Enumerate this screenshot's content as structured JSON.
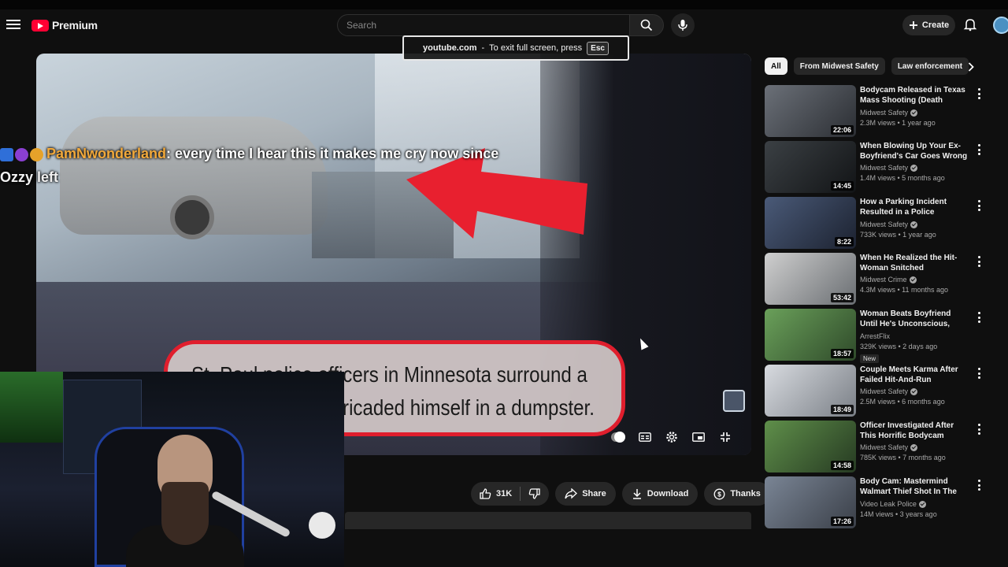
{
  "header": {
    "logo_text": "Premium",
    "search_placeholder": "Search",
    "create_label": "Create"
  },
  "fullscreen_toast": {
    "host": "youtube.com",
    "separator": "-",
    "message": "To exit full screen, press",
    "key": "Esc"
  },
  "video": {
    "caption_line1": "St. Paul police officers in Minnesota surround a",
    "caption_line2": "rricaded himself in a dumpster."
  },
  "chat": {
    "username": "PamNwonderland",
    "message": ": every time I hear this it makes me cry now since",
    "message_cont": "Ozzy left"
  },
  "actions": {
    "likes": "31K",
    "share": "Share",
    "download": "Download",
    "thanks": "Thanks"
  },
  "chips": [
    "All",
    "From Midwest Safety",
    "Law enforcement"
  ],
  "recommendations": [
    {
      "title": "Bodycam Released in Texas Mass Shooting (Death Penalty…",
      "channel": "Midwest Safety",
      "verified": true,
      "meta": "2.3M views • 1 year ago",
      "duration": "22:06",
      "new": ""
    },
    {
      "title": "When Blowing Up Your Ex-Boyfriend's Car Goes Wrong",
      "channel": "Midwest Safety",
      "verified": true,
      "meta": "1.4M views • 5 months ago",
      "duration": "14:45",
      "new": ""
    },
    {
      "title": "How a Parking Incident Resulted in a Police Shooting",
      "channel": "Midwest Safety",
      "verified": true,
      "meta": "733K views • 1 year ago",
      "duration": "8:22",
      "new": ""
    },
    {
      "title": "When He Realized the Hit-Woman Snitched",
      "channel": "Midwest Crime",
      "verified": true,
      "meta": "4.3M views • 11 months ago",
      "duration": "53:42",
      "new": ""
    },
    {
      "title": "Woman Beats Boyfriend Until He's Unconscious, Then Calls …",
      "channel": "ArrestFlix",
      "verified": false,
      "meta": "329K views • 2 days ago",
      "duration": "18:57",
      "new": "New"
    },
    {
      "title": "Couple Meets Karma After Failed Hit-And-Run",
      "channel": "Midwest Safety",
      "verified": true,
      "meta": "2.5M views • 6 months ago",
      "duration": "18:49",
      "new": ""
    },
    {
      "title": "Officer Investigated After This Horrific Bodycam",
      "channel": "Midwest Safety",
      "verified": true,
      "meta": "785K views • 7 months ago",
      "duration": "14:58",
      "new": ""
    },
    {
      "title": "Body Cam: Mastermind Walmart Thief Shot In The Hea…",
      "channel": "Video Leak Police",
      "verified": true,
      "meta": "14M views • 3 years ago",
      "duration": "17:26",
      "new": ""
    }
  ],
  "colors": {
    "brand_red": "#ff0033",
    "caption_border": "#e01e2d",
    "chat_username": "#f2a93b"
  }
}
